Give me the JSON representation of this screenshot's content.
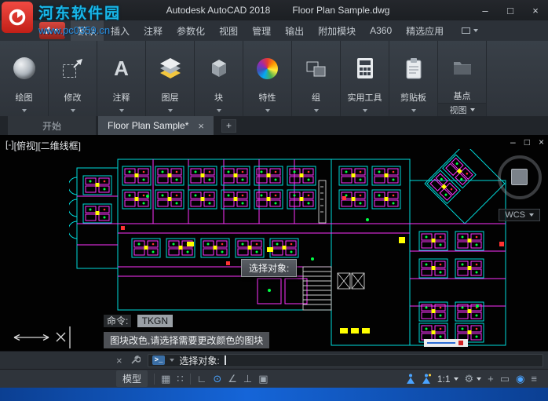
{
  "watermark": {
    "site_name": "河东软件园",
    "site_url": "www.pc0359.cn"
  },
  "title_bar": {
    "app_title": "Autodesk AutoCAD 2018",
    "doc_title": "Floor Plan Sample.dwg",
    "minimize_glyph": "–",
    "maximize_glyph": "□",
    "close_glyph": "×"
  },
  "app_button": {
    "label": "A"
  },
  "ribbon": {
    "tabs": [
      {
        "label": "默认",
        "active": true
      },
      {
        "label": "插入"
      },
      {
        "label": "注释"
      },
      {
        "label": "参数化"
      },
      {
        "label": "视图"
      },
      {
        "label": "管理"
      },
      {
        "label": "输出"
      },
      {
        "label": "附加模块"
      },
      {
        "label": "A360"
      },
      {
        "label": "精选应用"
      }
    ],
    "panels": [
      {
        "label": "绘图"
      },
      {
        "label": "修改"
      },
      {
        "label": "注释",
        "icon_glyph": "A"
      },
      {
        "label": "图层"
      },
      {
        "label": "块"
      },
      {
        "label": "特性"
      },
      {
        "label": "组"
      },
      {
        "label": "实用工具"
      },
      {
        "label": "剪贴板"
      },
      {
        "label": "基点"
      }
    ],
    "view_panel": {
      "label": "视图"
    }
  },
  "file_tabs": {
    "start_label": "开始",
    "active_label": "Floor Plan Sample*",
    "close_glyph": "×",
    "new_tab_glyph": "+"
  },
  "viewport": {
    "control_minus": "[-]",
    "control_view": "[俯视]",
    "control_visual": "[二维线框]",
    "wcs_label": "WCS",
    "doc_minimize": "–",
    "doc_restore": "□",
    "doc_close": "×"
  },
  "canvas_overlays": {
    "tooltip": "选择对象:",
    "history_prompt": "命令:",
    "history_command": "TKGN",
    "history_message": "图块改色,请选择需要更改颜色的图块"
  },
  "command_line": {
    "close_glyph": "×",
    "prompt_icon": ">_",
    "prompt": "选择对象:"
  },
  "status_bar": {
    "model_label": "模型",
    "scale_label": "1:1",
    "icons": [
      {
        "name": "grid-icon",
        "glyph": "▦"
      },
      {
        "name": "snap-icon",
        "glyph": "∷"
      },
      {
        "name": "ortho-icon",
        "glyph": "∟"
      },
      {
        "name": "polar-tracking-icon",
        "glyph": "⊙"
      },
      {
        "name": "isodraft-icon",
        "glyph": "∠"
      },
      {
        "name": "object-snap-tracking-icon",
        "glyph": "⊥"
      },
      {
        "name": "object-snap-icon",
        "glyph": "▣"
      },
      {
        "name": "add-icon",
        "glyph": "+"
      },
      {
        "name": "isolate-objects-icon",
        "glyph": "▭"
      },
      {
        "name": "graphics-performance-icon",
        "glyph": "◉"
      },
      {
        "name": "customization-menu-icon",
        "glyph": "≡"
      },
      {
        "name": "gear-icon",
        "glyph": "⚙"
      }
    ]
  },
  "colors": {
    "accent_blue": "#4aa3ff",
    "canvas_cyan": "#00dcdc",
    "canvas_magenta": "#ff33ff",
    "canvas_yellow": "#ffff00",
    "canvas_green": "#00ff44",
    "watermark_blue": "#18b7ea",
    "bottom_bar_blue": "#1565d8"
  }
}
